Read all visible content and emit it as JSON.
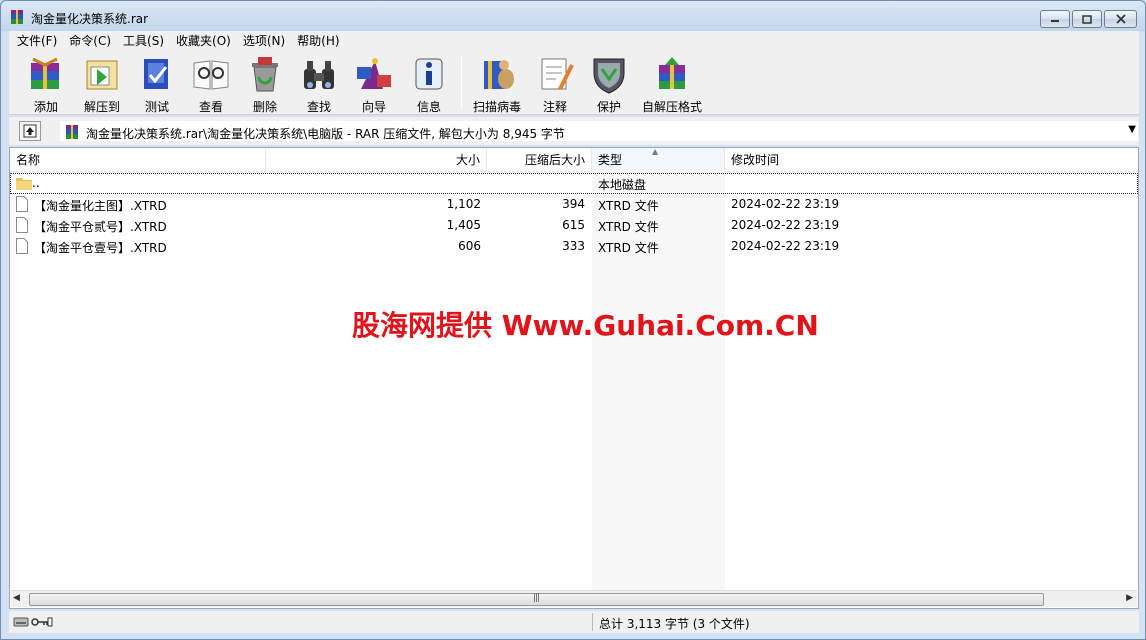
{
  "window": {
    "title": "淘金量化决策系统.rar"
  },
  "menu": [
    "文件(F)",
    "命令(C)",
    "工具(S)",
    "收藏夹(O)",
    "选项(N)",
    "帮助(H)"
  ],
  "toolbar": [
    {
      "label": "添加",
      "icon": "add-archive-icon"
    },
    {
      "label": "解压到",
      "icon": "extract-to-icon"
    },
    {
      "label": "测试",
      "icon": "test-icon"
    },
    {
      "label": "查看",
      "icon": "view-icon"
    },
    {
      "label": "删除",
      "icon": "delete-icon"
    },
    {
      "label": "查找",
      "icon": "find-icon"
    },
    {
      "label": "向导",
      "icon": "wizard-icon"
    },
    {
      "label": "信息",
      "icon": "info-icon"
    },
    {
      "label": "扫描病毒",
      "icon": "virus-scan-icon"
    },
    {
      "label": "注释",
      "icon": "comment-icon"
    },
    {
      "label": "保护",
      "icon": "protect-icon"
    },
    {
      "label": "自解压格式",
      "icon": "sfx-icon"
    }
  ],
  "address": {
    "path": "淘金量化决策系统.rar\\淘金量化决策系统\\电脑版 - RAR 压缩文件, 解包大小为 8,945 字节"
  },
  "columns": [
    "名称",
    "大小",
    "压缩后大小",
    "类型",
    "修改时间"
  ],
  "parent_row": {
    "name": "..",
    "type": "本地磁盘"
  },
  "files": [
    {
      "name": "【淘金量化主图】.XTRD",
      "size": "1,102",
      "packed": "394",
      "type": "XTRD 文件",
      "modified": "2024-02-22 23:19"
    },
    {
      "name": "【淘金平仓贰号】.XTRD",
      "size": "1,405",
      "packed": "615",
      "type": "XTRD 文件",
      "modified": "2024-02-22 23:19"
    },
    {
      "name": "【淘金平仓壹号】.XTRD",
      "size": "606",
      "packed": "333",
      "type": "XTRD 文件",
      "modified": "2024-02-22 23:19"
    }
  ],
  "watermark": "股海网提供 Www.Guhai.Com.CN",
  "status": {
    "text": "总计 3,113 字节 (3 个文件)"
  }
}
